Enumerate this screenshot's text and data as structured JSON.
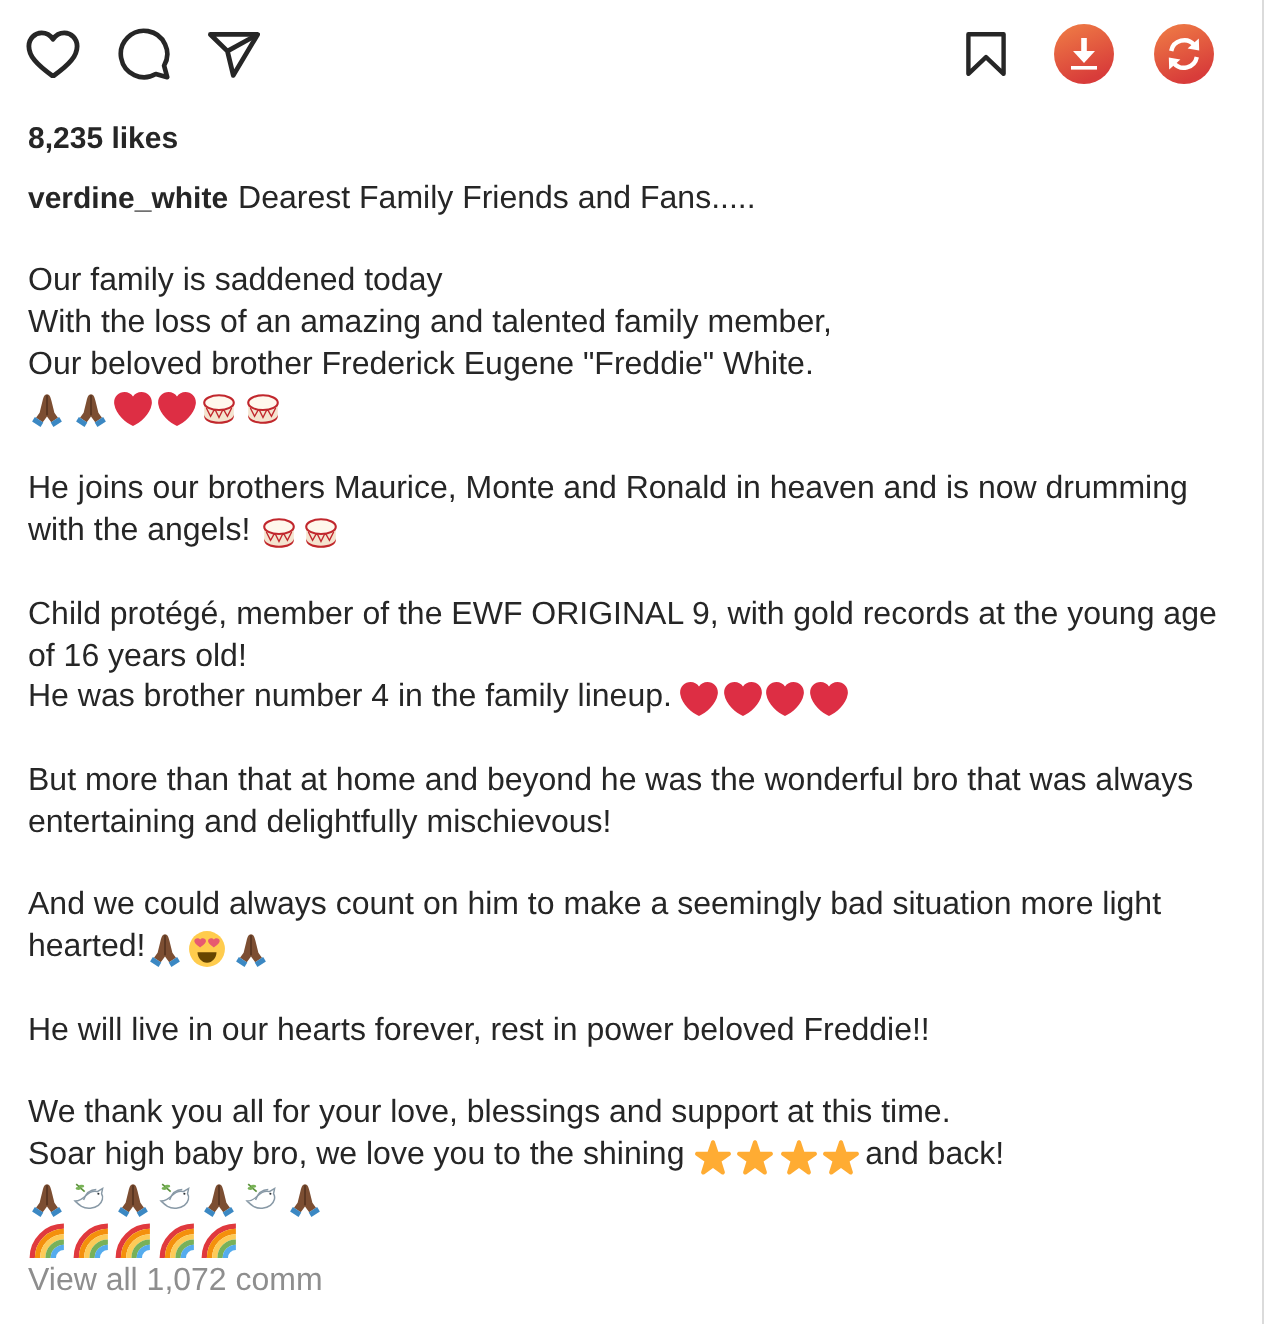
{
  "actions": {
    "liked": false,
    "saved": false
  },
  "likes": "8,235 likes",
  "caption": {
    "username": "verdine_white",
    "text": "Dearest Family Friends and Fans.....",
    "paragraphs": [
      {
        "lines": [
          [
            {
              "kind": "text",
              "text": "Our family is saddened today"
            }
          ],
          [
            {
              "kind": "text",
              "text": "With the loss of an amazing and talented family member,"
            }
          ],
          [
            {
              "kind": "text",
              "text": "Our beloved brother Frederick Eugene \"Freddie\" White."
            }
          ],
          [
            {
              "kind": "pray"
            },
            {
              "kind": "pray"
            },
            {
              "kind": "heart"
            },
            {
              "kind": "heart"
            },
            {
              "kind": "drum"
            },
            {
              "kind": "drum"
            }
          ]
        ]
      },
      {
        "lines": [
          [
            {
              "kind": "text",
              "text": "He joins our brothers Maurice, Monte and Ronald in heaven and is now drumming"
            }
          ],
          [
            {
              "kind": "text",
              "text": "with the angels! "
            },
            {
              "kind": "drum"
            },
            {
              "kind": "drum"
            }
          ]
        ]
      },
      {
        "lines": [
          [
            {
              "kind": "text",
              "text": "Child protégé, member of the EWF ORIGINAL 9, with gold records at the young age"
            }
          ],
          [
            {
              "kind": "text",
              "text": "of 16 years old!"
            }
          ],
          [
            {
              "kind": "text",
              "text": "He was brother number 4 in the family lineup. "
            },
            {
              "kind": "heart"
            },
            {
              "kind": "heart"
            },
            {
              "kind": "heart"
            },
            {
              "kind": "heart"
            }
          ]
        ]
      },
      {
        "lines": [
          [
            {
              "kind": "text",
              "text": "But more than that at home and beyond he was the wonderful bro that was always"
            }
          ],
          [
            {
              "kind": "text",
              "text": "entertaining and delightfully mischievous!"
            }
          ]
        ]
      },
      {
        "lines": [
          [
            {
              "kind": "text",
              "text": "And we could always count on him to make a seemingly bad situation more light"
            }
          ],
          [
            {
              "kind": "text",
              "text": "hearted!"
            },
            {
              "kind": "pray"
            },
            {
              "kind": "smitten"
            },
            {
              "kind": "pray"
            }
          ]
        ]
      },
      {
        "lines": [
          [
            {
              "kind": "text",
              "text": "He will live in our hearts forever, rest in power beloved Freddie!!"
            }
          ]
        ]
      },
      {
        "lines": [
          [
            {
              "kind": "text",
              "text": "We thank you all for your love, blessings and support at this time."
            }
          ],
          [
            {
              "kind": "text",
              "text": "Soar high baby bro, we love you to the shining "
            },
            {
              "kind": "star"
            },
            {
              "kind": "star"
            },
            {
              "kind": "star"
            },
            {
              "kind": "star"
            },
            {
              "kind": "text",
              "text": "and back!"
            }
          ],
          [
            {
              "kind": "pray"
            },
            {
              "kind": "dove"
            },
            {
              "kind": "pray"
            },
            {
              "kind": "dove"
            },
            {
              "kind": "pray"
            },
            {
              "kind": "dove"
            },
            {
              "kind": "pray"
            }
          ],
          [
            {
              "kind": "rainbow"
            },
            {
              "kind": "rainbow"
            },
            {
              "kind": "rainbow"
            },
            {
              "kind": "rainbow"
            },
            {
              "kind": "rainbow"
            }
          ]
        ]
      }
    ]
  },
  "comments_link": "View all 1,072 comm"
}
